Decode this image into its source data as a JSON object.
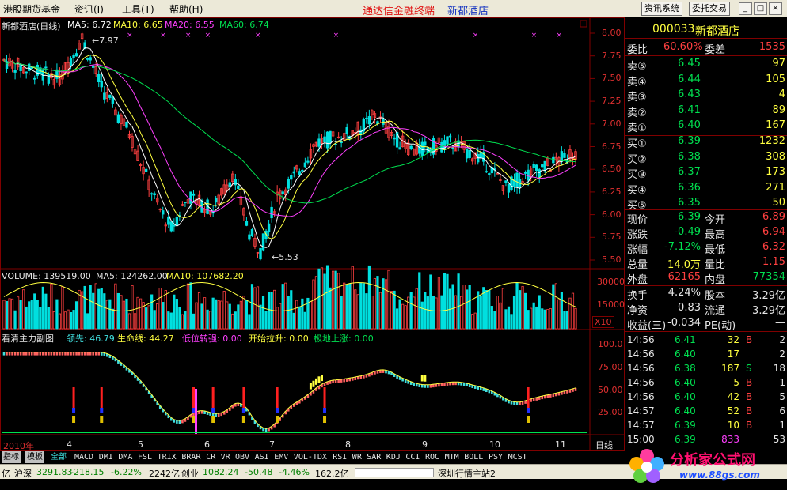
{
  "menubar": {
    "items": [
      "港股期货基金",
      "资讯(I)",
      "工具(T)",
      "帮助(H)"
    ],
    "app_title": "通达信金融终端",
    "stock_title": "新都酒店",
    "buttons": [
      "资讯系统",
      "委托交易"
    ],
    "window_buttons": [
      "_",
      "□",
      "×"
    ]
  },
  "chart": {
    "title": "新都酒店(日线)",
    "ma_labels": [
      {
        "text": "MA5: 6.72",
        "color": "#ffffff"
      },
      {
        "text": "MA10: 6.65",
        "color": "#ffff40"
      },
      {
        "text": "MA20: 6.55",
        "color": "#ff40ff"
      },
      {
        "text": "MA60: 6.74",
        "color": "#00e050"
      }
    ],
    "high_mark": "7.97",
    "low_mark": "5.53",
    "price_axis": [
      "8.00",
      "7.75",
      "7.50",
      "7.25",
      "7.00",
      "6.75",
      "6.50",
      "6.25",
      "6.00",
      "5.75",
      "5.50"
    ],
    "volume_label": "VOLUME: 139519.00",
    "volume_ma5": "MA5: 124262.00",
    "volume_ma10": "MA10: 107682.20",
    "volume_axis": [
      "30000",
      "15000"
    ],
    "volume_unit": "X10",
    "sub_title": "看清主力副图",
    "sub_labels": [
      {
        "text": "领先: 46.79",
        "color": "#40e0e0"
      },
      {
        "text": "生命线: 44.27",
        "color": "#ffff40"
      },
      {
        "text": "低位转强: 0.00",
        "color": "#ff40ff"
      },
      {
        "text": "开始拉升: 0.00",
        "color": "#ffff40"
      },
      {
        "text": "极地上涨: 0.00",
        "color": "#00e050"
      }
    ],
    "sub_axis": [
      "100.0",
      "75.00",
      "50.00",
      "25.00"
    ],
    "time_axis": [
      "2010年",
      "4",
      "5",
      "6",
      "7",
      "8",
      "9",
      "10",
      "11"
    ],
    "period": "日线"
  },
  "panel": {
    "code": "000033",
    "name": "新都酒店",
    "weibi_label": "委比",
    "weibi": "60.60%",
    "weicha_label": "委差",
    "weicha": "1535",
    "sell": [
      {
        "label": "卖⑤",
        "price": "6.45",
        "vol": "97"
      },
      {
        "label": "卖④",
        "price": "6.44",
        "vol": "105"
      },
      {
        "label": "卖③",
        "price": "6.43",
        "vol": "4"
      },
      {
        "label": "卖②",
        "price": "6.41",
        "vol": "89"
      },
      {
        "label": "卖①",
        "price": "6.40",
        "vol": "167"
      }
    ],
    "buy": [
      {
        "label": "买①",
        "price": "6.39",
        "vol": "1232"
      },
      {
        "label": "买②",
        "price": "6.38",
        "vol": "308"
      },
      {
        "label": "买③",
        "price": "6.37",
        "vol": "173"
      },
      {
        "label": "买④",
        "price": "6.36",
        "vol": "271"
      },
      {
        "label": "买⑤",
        "price": "6.35",
        "vol": "50"
      }
    ],
    "stats": [
      {
        "l1": "现价",
        "v1": "6.39",
        "c1": "g",
        "l2": "今开",
        "v2": "6.89",
        "c2": "r"
      },
      {
        "l1": "涨跌",
        "v1": "-0.49",
        "c1": "g",
        "l2": "最高",
        "v2": "6.94",
        "c2": "r"
      },
      {
        "l1": "涨幅",
        "v1": "-7.12%",
        "c1": "g",
        "l2": "最低",
        "v2": "6.32",
        "c2": "r"
      },
      {
        "l1": "总量",
        "v1": "14.0万",
        "c1": "y",
        "l2": "量比",
        "v2": "1.15",
        "c2": "r"
      },
      {
        "l1": "外盘",
        "v1": "62165",
        "c1": "r",
        "l2": "内盘",
        "v2": "77354",
        "c2": "g"
      }
    ],
    "stats2": [
      {
        "l1": "换手",
        "v1": "4.24%",
        "l2": "股本",
        "v2": "3.29亿"
      },
      {
        "l1": "净资",
        "v1": "0.83",
        "l2": "流通",
        "v2": "3.29亿"
      },
      {
        "l1": "收益(三)",
        "v1": "-0.034",
        "l2": "PE(动)",
        "v2": "—"
      }
    ],
    "ticks": [
      {
        "t": "14:56",
        "p": "6.41",
        "v": "32",
        "s": "B",
        "n": "2"
      },
      {
        "t": "14:56",
        "p": "6.40",
        "v": "17",
        "s": "",
        "n": "2"
      },
      {
        "t": "14:56",
        "p": "6.38",
        "v": "187",
        "s": "S",
        "n": "18"
      },
      {
        "t": "14:56",
        "p": "6.40",
        "v": "5",
        "s": "B",
        "n": "1"
      },
      {
        "t": "14:56",
        "p": "6.40",
        "v": "42",
        "s": "B",
        "n": "5"
      },
      {
        "t": "14:57",
        "p": "6.40",
        "v": "52",
        "s": "B",
        "n": "6"
      },
      {
        "t": "14:57",
        "p": "6.39",
        "v": "10",
        "s": "B",
        "n": "1"
      },
      {
        "t": "15:00",
        "p": "6.39",
        "v": "833",
        "s": "",
        "n": "53"
      }
    ]
  },
  "tabs": [
    "指标",
    "模板",
    "全部",
    "MACD",
    "DMI",
    "DMA",
    "FSL",
    "TRIX",
    "BRAR",
    "CR",
    "VR",
    "OBV",
    "ASI",
    "EMV",
    "VOL-TDX",
    "RSI",
    "WR",
    "SAR",
    "KDJ",
    "CCI",
    "ROC",
    "MTM",
    "BOLL",
    "PSY",
    "MCST"
  ],
  "status": {
    "prefix": "亿",
    "sh_label": "沪深",
    "sh_value": "3291.83",
    "sh_change": "-218.15",
    "sh_pct": "-6.22%",
    "sh_amount": "2242亿",
    "cy_label": "创业",
    "cy_value": "1082.24",
    "cy_change": "-50.48",
    "cy_pct": "-4.46%",
    "cy_amount": "162.2亿",
    "server": "深圳行情主站2"
  },
  "watermark": {
    "name": "分析家公式网",
    "url": "www.88gs.com"
  },
  "colors": {
    "up": "#ff4040",
    "down": "#00e0e0",
    "ma5": "#ffffff",
    "ma10": "#ffff40",
    "ma20": "#ff40ff",
    "ma60": "#00e050",
    "grid": "#800000"
  }
}
